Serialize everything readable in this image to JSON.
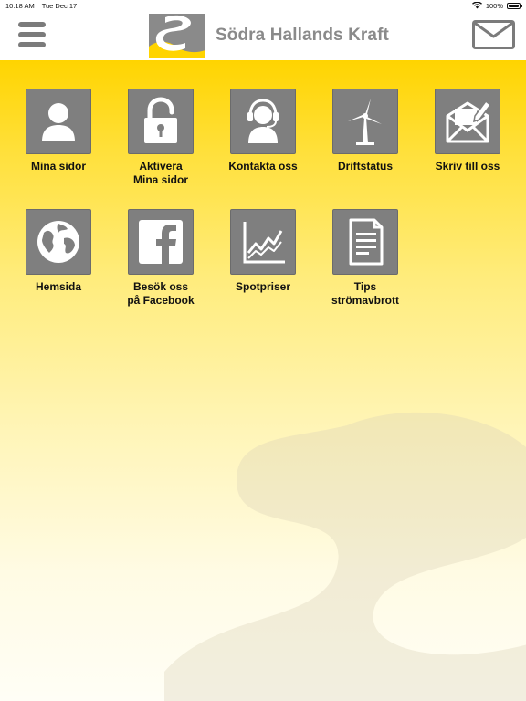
{
  "status_bar": {
    "time": "10:18 AM",
    "date": "Tue Dec 17",
    "battery": "100%"
  },
  "header": {
    "title": "Södra Hallands Kraft",
    "menu_icon": "hamburger-icon",
    "mail_icon": "envelope-icon",
    "colors": {
      "brand_gray": "#7f7f7f",
      "brand_yellow": "#ffd400"
    }
  },
  "tiles": [
    {
      "label": "Mina sidor",
      "icon": "user-icon"
    },
    {
      "label": "Aktivera\nMina sidor",
      "icon": "unlock-icon"
    },
    {
      "label": "Kontakta oss",
      "icon": "headset-icon"
    },
    {
      "label": "Driftstatus",
      "icon": "wind-turbine-icon"
    },
    {
      "label": "Skriv till oss",
      "icon": "write-mail-icon"
    },
    {
      "label": "Hemsida",
      "icon": "globe-icon"
    },
    {
      "label": "Besök oss\npå Facebook",
      "icon": "facebook-icon"
    },
    {
      "label": "Spotpriser",
      "icon": "chart-icon"
    },
    {
      "label": "Tips\nströmavbrott",
      "icon": "document-icon"
    }
  ]
}
